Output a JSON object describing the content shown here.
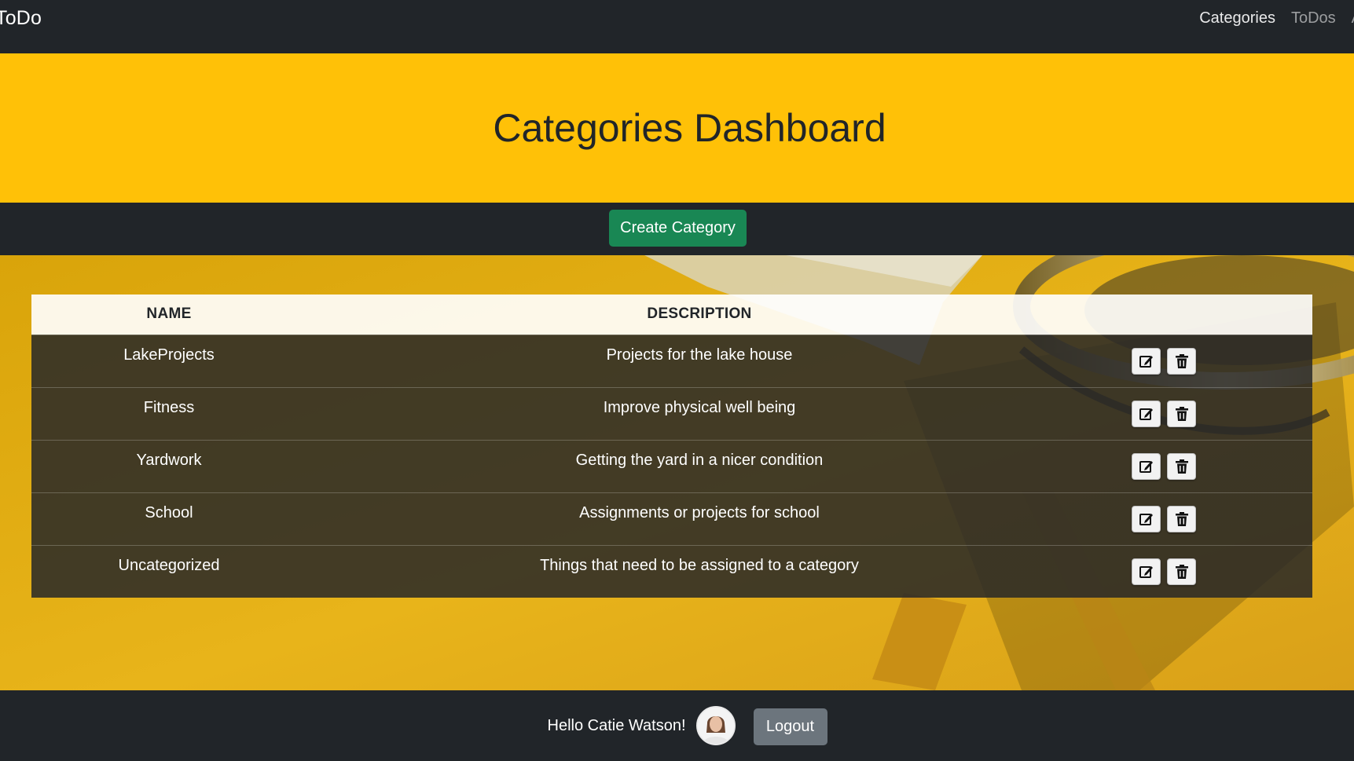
{
  "navbar": {
    "brand": "ToDo",
    "links": [
      {
        "label": "Categories",
        "active": true
      },
      {
        "label": "ToDos",
        "active": false
      },
      {
        "label": "A",
        "active": false
      }
    ]
  },
  "hero": {
    "title": "Categories Dashboard"
  },
  "actions": {
    "create_label": "Create Category"
  },
  "table": {
    "columns": [
      "NAME",
      "DESCRIPTION",
      ""
    ],
    "rows": [
      {
        "name": "LakeProjects",
        "description": "Projects for the lake house"
      },
      {
        "name": "Fitness",
        "description": "Improve physical well being"
      },
      {
        "name": "Yardwork",
        "description": "Getting the yard in a nicer condition"
      },
      {
        "name": "School",
        "description": "Assignments or projects for school"
      },
      {
        "name": "Uncategorized",
        "description": "Things that need to be assigned to a category"
      }
    ],
    "row_icons": [
      "edit-icon",
      "trash-icon"
    ]
  },
  "footer": {
    "greeting": "Hello Catie Watson!",
    "logout_label": "Logout"
  },
  "colors": {
    "navbar": "#212529",
    "hero": "#ffc107",
    "create_button": "#198754",
    "logout_button": "#6c757d"
  }
}
